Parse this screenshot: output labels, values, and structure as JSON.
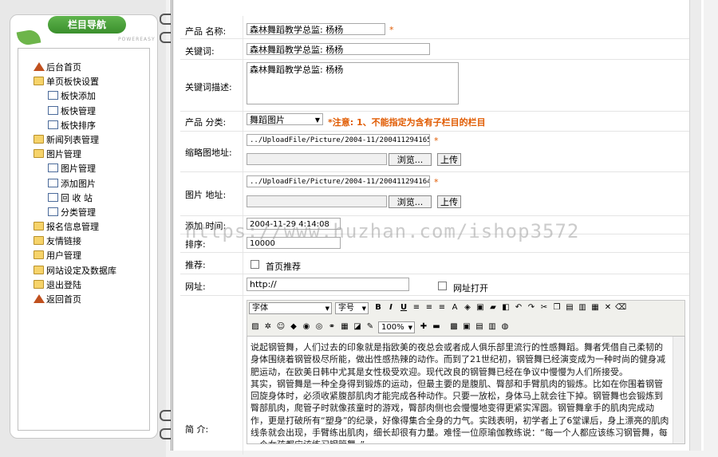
{
  "nav": {
    "title": "栏目导航",
    "subtitle": "POWEREASY",
    "items": [
      {
        "label": "后台首页",
        "icon": "home-icon",
        "sub": false
      },
      {
        "label": "单页板快设置",
        "icon": "folder-open-icon",
        "sub": false
      },
      {
        "label": "板快添加",
        "icon": "page-icon",
        "sub": true
      },
      {
        "label": "板快管理",
        "icon": "page-icon",
        "sub": true
      },
      {
        "label": "板快排序",
        "icon": "page-icon",
        "sub": true
      },
      {
        "label": "新闻列表管理",
        "icon": "folder-icon",
        "sub": false
      },
      {
        "label": "图片管理",
        "icon": "folder-open-icon",
        "sub": false
      },
      {
        "label": "图片管理",
        "icon": "page-icon",
        "sub": true
      },
      {
        "label": "添加图片",
        "icon": "page-icon",
        "sub": true
      },
      {
        "label": "回 收 站",
        "icon": "page-icon",
        "sub": true
      },
      {
        "label": "分类管理",
        "icon": "page-icon",
        "sub": true
      },
      {
        "label": "报名信息管理",
        "icon": "folder-icon",
        "sub": false
      },
      {
        "label": "友情链接",
        "icon": "folder-icon",
        "sub": false
      },
      {
        "label": "用户管理",
        "icon": "folder-icon",
        "sub": false
      },
      {
        "label": "网站设定及数据库",
        "icon": "folder-icon",
        "sub": false
      },
      {
        "label": "退出登陆",
        "icon": "folder-icon",
        "sub": false
      },
      {
        "label": "返回首页",
        "icon": "home-icon",
        "sub": false
      }
    ]
  },
  "form": {
    "name_label": "产品  名称:",
    "name_value": "森林舞蹈教学总监: 杨杨",
    "keywords_label": "关键词:",
    "keywords_value": "森林舞蹈教学总监: 杨杨",
    "desc_label": "关键词描述:",
    "desc_value": "森林舞蹈教学总监: 杨杨",
    "category_label": "产品  分类:",
    "category_value": "舞蹈图片",
    "category_note": "*注意: 1、不能指定为含有子栏目的栏目",
    "thumb_label": "缩略图地址:",
    "thumb_value": "../UploadFile/Picture/2004-11/200411294165",
    "image_label": "图片  地址:",
    "image_value": "../UploadFile/Picture/2004-11/200411294164",
    "browse_label": "浏览...",
    "upload_label": "上传",
    "time_label": "添加  时间:",
    "time_value": "2004-11-29 4:14:08",
    "sort_label": "排序:",
    "sort_value": "10000",
    "recommend_label": "推荐:",
    "recommend_option": "首页推荐",
    "url_label": "网址:",
    "url_value": "http://",
    "url_open_label": "网址打开",
    "intro_label": "简      介:",
    "star": "*"
  },
  "editor": {
    "font_select": "字体",
    "size_select": "字号",
    "zoom_select": "100%",
    "text": "    说起钢管舞，人们过去的印象就是指欧美的夜总会或者成人俱乐部里流行的性感舞蹈。舞者凭借自己柔韧的身体围绕着钢管极尽所能，做出性感热辣的动作。而到了21世纪初，钢管舞已经演变成为一种时尚的健身减肥运动，在欧美日韩中尤其是女性极受欢迎。现代改良的钢管舞已经在争议中慢慢为人们所接受。\n    其实，钢管舞是一种全身得到锻炼的运动，但最主要的是腹肌、臀部和手臂肌肉的锻炼。比如在你围着钢管回旋身体时，必须收紧腹部肌肉才能完成各种动作。只要一放松，身体马上就会往下掉。钢管舞也会锻炼到臀部肌肉，爬管子时就像孩童时的游戏，臀部肉侧也会慢慢地变得更紧实浑圆。钢管舞拿手的肌肉完成动作，更是打破所有“塑身”的纪录，好像得集合全身的力气。实践表明，初学者上了6堂课后，身上漂亮的肌肉线条就会出现，手臂练出肌肉，细长却很有力量。难怪一位原瑜伽教练说：“每一个人都应该练习钢管舞，每一个女孩都应该练习钢管舞。”"
  },
  "watermark": "https://www.huzhan.com/ishop3572",
  "colors": {
    "accent_green": "#4aa33a",
    "required_star": "#e05a00"
  }
}
